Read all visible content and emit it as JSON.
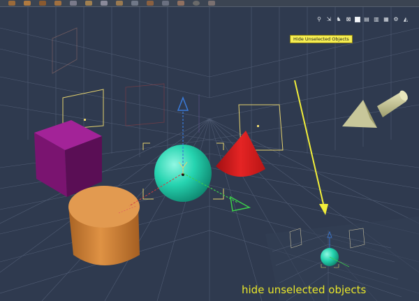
{
  "toolbar": {
    "icons": [
      "select-icon",
      "translate-icon",
      "rotate-icon",
      "scale-icon",
      "primitive-icon",
      "light-icon",
      "camera-icon",
      "deform-icon",
      "render-icon",
      "texture-icon",
      "physics-icon",
      "fx-icon",
      "sphere-icon",
      "pin-icon"
    ]
  },
  "view_controls": {
    "icons": [
      "hierarchy-icon",
      "scale-pivot-icon",
      "walk-icon",
      "hide-unselected-icon",
      "single-view-icon",
      "dual-view-icon",
      "triple-view-icon",
      "quad-view-icon",
      "view-settings-icon",
      "render-view-icon"
    ],
    "active": "hide-unselected-icon"
  },
  "tooltip": {
    "text": "Hide Unselected Objects"
  },
  "caption": {
    "text": "hide unselected objects"
  },
  "colors": {
    "background": "#2f3a4f",
    "grid": "#56627a",
    "cube": "#8b1a7f",
    "sphere": "#26d4b0",
    "cone": "#d91c1c",
    "cylinder": "#d88a3e",
    "arrow": "#c8c79a",
    "gizmo_y": "#3a7ad8",
    "gizmo_x": "#3ccf4a",
    "selection": "#e6d36e",
    "highlight": "#f2ef3a"
  }
}
